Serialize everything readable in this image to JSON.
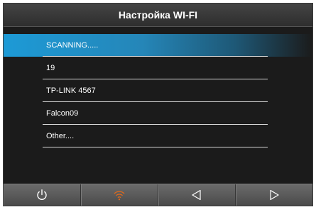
{
  "header": {
    "title": "Настройка WI-FI"
  },
  "networks": [
    {
      "label": "SCANNING.....",
      "active": true
    },
    {
      "label": "19",
      "active": false
    },
    {
      "label": "TP-LINK 4567",
      "active": false
    },
    {
      "label": "Falcon09",
      "active": false
    },
    {
      "label": "Other....",
      "active": false
    }
  ],
  "toolbar": {
    "buttons": [
      {
        "icon": "power-icon",
        "color": "#ffffff"
      },
      {
        "icon": "wifi-icon",
        "color": "#e36a1a"
      },
      {
        "icon": "triangle-left-icon",
        "color": "#ffffff"
      },
      {
        "icon": "triangle-right-icon",
        "color": "#ffffff"
      }
    ]
  },
  "colors": {
    "accent": "#1d9ad6",
    "wifi_active": "#e36a1a"
  }
}
